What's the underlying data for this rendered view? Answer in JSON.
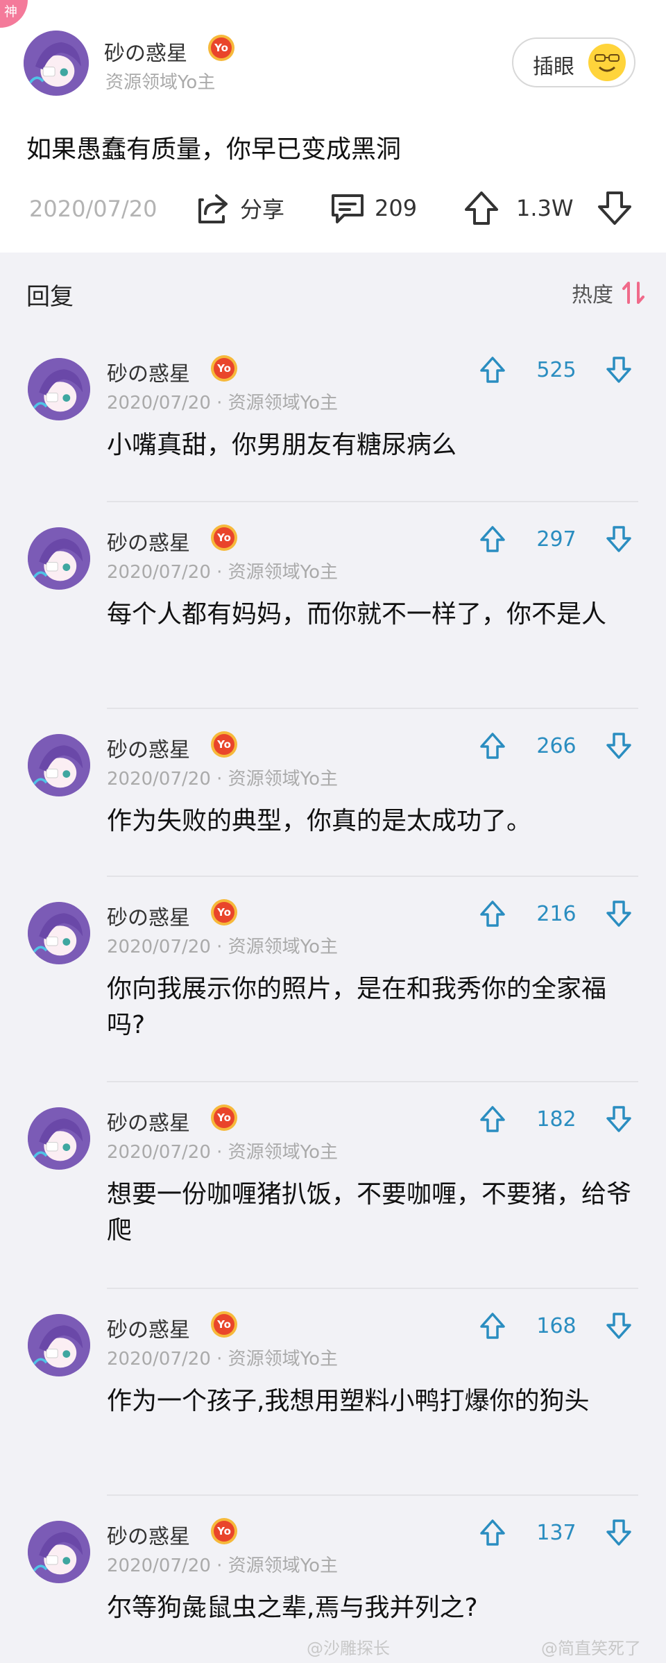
{
  "badge": "神",
  "post": {
    "author": "砂の惑星",
    "yo": "Yo",
    "subtitle": "资源领域Yo主",
    "insert_label": "插眼",
    "text": "如果愚蠢有质量，你早已变成黑洞",
    "date": "2020/07/20",
    "share_label": "分享",
    "comments": "209",
    "likes": "1.3W"
  },
  "replies_header": {
    "title": "回复",
    "sort_label": "热度"
  },
  "replies": [
    {
      "author": "砂の惑星",
      "yo": "Yo",
      "meta": "2020/07/20 · 资源领域Yo主",
      "votes": "525",
      "text": "小嘴真甜，你男朋友有糖尿病么"
    },
    {
      "author": "砂の惑星",
      "yo": "Yo",
      "meta": "2020/07/20 · 资源领域Yo主",
      "votes": "297",
      "text": "每个人都有妈妈，而你就不一样了，你不是人"
    },
    {
      "author": "砂の惑星",
      "yo": "Yo",
      "meta": "2020/07/20 · 资源领域Yo主",
      "votes": "266",
      "text": "作为失败的典型，你真的是太成功了。"
    },
    {
      "author": "砂の惑星",
      "yo": "Yo",
      "meta": "2020/07/20 · 资源领域Yo主",
      "votes": "216",
      "text": "你向我展示你的照片，是在和我秀你的全家福吗?"
    },
    {
      "author": "砂の惑星",
      "yo": "Yo",
      "meta": "2020/07/20 · 资源领域Yo主",
      "votes": "182",
      "text": "想要一份咖喱猪扒饭，不要咖喱，不要猪，给爷爬"
    },
    {
      "author": "砂の惑星",
      "yo": "Yo",
      "meta": "2020/07/20 · 资源领域Yo主",
      "votes": "168",
      "text": "作为一个孩子,我想用塑料小鸭打爆你的狗头"
    },
    {
      "author": "砂の惑星",
      "yo": "Yo",
      "meta": "2020/07/20 · 资源领域Yo主",
      "votes": "137",
      "text": "尔等狗彘鼠虫之辈,焉与我并列之?"
    }
  ],
  "watermarks": [
    "@沙雕探长",
    "@简直笑死了"
  ],
  "colors": {
    "accent": "#2a8dc0",
    "badge_pink": "#f47a9a",
    "sort_pink": "#f06a8a"
  }
}
